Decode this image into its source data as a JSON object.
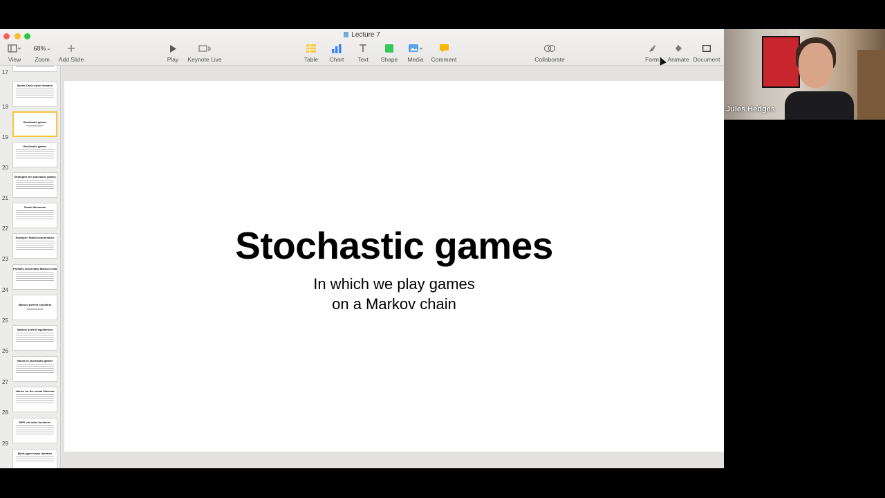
{
  "window": {
    "title": "Lecture 7"
  },
  "toolbar": {
    "view_label": "View",
    "zoom_value": "68%",
    "zoom_label": "Zoom",
    "add_slide_label": "Add Slide",
    "play_label": "Play",
    "keynote_live_label": "Keynote Live",
    "table_label": "Table",
    "chart_label": "Chart",
    "text_label": "Text",
    "shape_label": "Shape",
    "media_label": "Media",
    "comment_label": "Comment",
    "collaborate_label": "Collaborate",
    "format_label": "Form",
    "animate_label": "Animate",
    "document_label": "Document"
  },
  "sidebar": {
    "slides": [
      {
        "number": "17",
        "title": ""
      },
      {
        "number": "18",
        "title": "Monte Carlo value iteration"
      },
      {
        "number": "19",
        "title": "Stochastic games"
      },
      {
        "number": "20",
        "title": "Stochastic games"
      },
      {
        "number": "21",
        "title": "Strategies for stochastic games"
      },
      {
        "number": "22",
        "title": "Social dilemmas"
      },
      {
        "number": "23",
        "title": "Example: Robot coordination"
      },
      {
        "number": "24",
        "title": "Partially observable Markov chains"
      },
      {
        "number": "25",
        "title": "Markov perfect equilibria"
      },
      {
        "number": "26",
        "title": "Markov perfect equilibrium"
      },
      {
        "number": "27",
        "title": "Values in stochastic games"
      },
      {
        "number": "28",
        "title": "Values for the social dilemma"
      },
      {
        "number": "29",
        "title": "MPE via value functions"
      },
      {
        "number": "",
        "title": "Multi-agent value iteration"
      }
    ],
    "selected_number": "19"
  },
  "slide": {
    "title": "Stochastic games",
    "subtitle_line1": "In which we play games",
    "subtitle_line2": "on a Markov chain"
  },
  "video": {
    "participant_name": "Jules Hedges"
  },
  "colors": {
    "selection": "#f5c542",
    "toolbar_accent": "#3b82f6",
    "close": "#fe5f57",
    "minimize": "#febc2e",
    "zoom": "#28c840"
  }
}
